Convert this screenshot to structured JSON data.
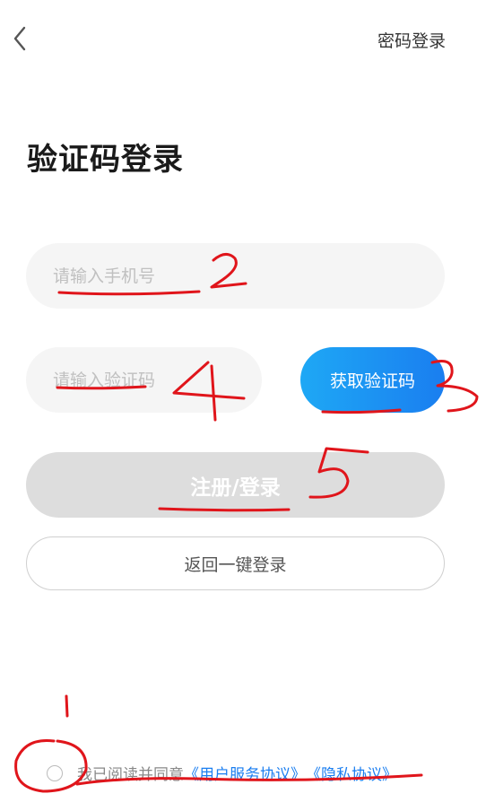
{
  "header": {
    "back_icon": "chevron-left-icon",
    "password_login": "密码登录"
  },
  "page": {
    "title": "验证码登录"
  },
  "form": {
    "phone_placeholder": "请输入手机号",
    "code_placeholder": "请输入验证码",
    "get_code_label": "获取验证码",
    "submit_label": "注册/登录",
    "back_oneclick_label": "返回一键登录"
  },
  "agreement": {
    "text": "我已阅读并同意",
    "user_agreement": "《用户服务协议》",
    "privacy_policy": "《隐私协议》"
  },
  "annotations": {
    "n1": "1",
    "n2": "2",
    "n3": "3",
    "n4": "4",
    "n5": "5"
  },
  "colors": {
    "accent_start": "#1ea8f5",
    "accent_end": "#1a7ef0",
    "link": "#1a7ef0",
    "annotation": "#e0151b",
    "input_bg": "#f5f5f5",
    "submit_disabled": "#dddddd"
  }
}
